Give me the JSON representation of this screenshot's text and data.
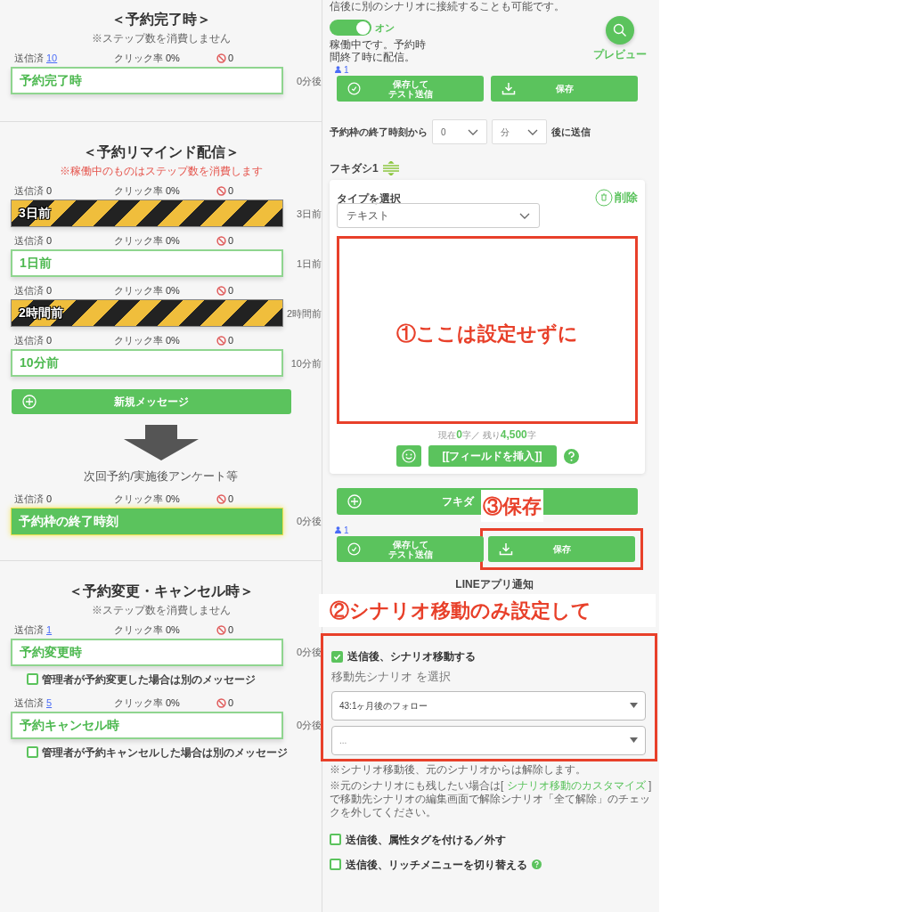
{
  "sections": [
    {
      "title": "＜予約完了時＞",
      "note": "※ステップ数を消費しません",
      "warning": false,
      "items": [
        {
          "kind": "message",
          "sent_label": "送信済",
          "sent": "10",
          "sent_link": true,
          "click_label": "クリック率",
          "click": "0%",
          "blocked": "0",
          "label": "予約完了時",
          "active": true,
          "selected": false,
          "timing": "0分後"
        }
      ]
    },
    {
      "title": "＜予約リマインド配信＞",
      "note": "※稼働中のものはステップ数を消費します",
      "warning": true,
      "items": [
        {
          "kind": "message",
          "sent_label": "送信済",
          "sent": "0",
          "sent_link": false,
          "click_label": "クリック率",
          "click": "0%",
          "blocked": "0",
          "label": "3日前",
          "active": false,
          "selected": false,
          "timing": "3日前"
        },
        {
          "kind": "message",
          "sent_label": "送信済",
          "sent": "0",
          "sent_link": false,
          "click_label": "クリック率",
          "click": "0%",
          "blocked": "0",
          "label": "1日前",
          "active": true,
          "selected": false,
          "timing": "1日前"
        },
        {
          "kind": "message",
          "sent_label": "送信済",
          "sent": "0",
          "sent_link": false,
          "click_label": "クリック率",
          "click": "0%",
          "blocked": "0",
          "label": "2時間前",
          "active": false,
          "selected": false,
          "timing": "2時間前"
        },
        {
          "kind": "message",
          "sent_label": "送信済",
          "sent": "0",
          "sent_link": false,
          "click_label": "クリック率",
          "click": "0%",
          "blocked": "0",
          "label": "10分前",
          "active": true,
          "selected": false,
          "timing": "10分前"
        },
        {
          "kind": "add_button",
          "label": "新規メッセージ"
        },
        {
          "kind": "arrow",
          "label": "次回予約/実施後アンケート等"
        },
        {
          "kind": "message",
          "sent_label": "送信済",
          "sent": "0",
          "sent_link": false,
          "click_label": "クリック率",
          "click": "0%",
          "blocked": "0",
          "label": "予約枠の終了時刻",
          "active": true,
          "selected": true,
          "timing": "0分後"
        }
      ]
    },
    {
      "title": "＜予約変更・キャンセル時＞",
      "note": "※ステップ数を消費しません",
      "warning": false,
      "items": [
        {
          "kind": "message",
          "sent_label": "送信済",
          "sent": "1",
          "sent_link": true,
          "click_label": "クリック率",
          "click": "0%",
          "blocked": "0",
          "label": "予約変更時",
          "active": true,
          "selected": false,
          "timing": "0分後"
        },
        {
          "kind": "checkbox",
          "label": "管理者が予約変更した場合は別のメッセージ",
          "checked": false
        },
        {
          "kind": "message",
          "sent_label": "送信済",
          "sent": "5",
          "sent_link": true,
          "click_label": "クリック率",
          "click": "0%",
          "blocked": "0",
          "label": "予約キャンセル時",
          "active": true,
          "selected": false,
          "timing": "0分後"
        },
        {
          "kind": "checkbox",
          "label": "管理者が予約キャンセルした場合は別のメッセージ",
          "checked": false
        }
      ]
    }
  ],
  "editor": {
    "top_note": "信後に別のシナリオに接続することも可能です。",
    "toggle": {
      "on": true,
      "label": "オン",
      "status": "稼働中です。予約時間終了時に配信。"
    },
    "preview": "プレビュー",
    "recipients": "1",
    "test_button": [
      "保存して",
      "テスト送信"
    ],
    "save_button": "保存",
    "timing": {
      "prefix": "予約枠の終了時刻から",
      "amount": "0",
      "unit": "分",
      "suffix": "後に送信"
    },
    "bubble": {
      "title": "フキダシ1",
      "type_label": "タイプを選択",
      "delete": "削除",
      "type": "テキスト",
      "counter": {
        "prefix": "現在",
        "current": "0",
        "middle": "字／ 残り",
        "remaining": "4,500",
        "suffix": "字"
      },
      "insert_field": "[[フィールドを挿入]]"
    },
    "add_bubble": "フキダ",
    "recipients_2": "1",
    "test_button_2": [
      "保存して",
      "テスト送信"
    ],
    "save_button_2": "保存",
    "line_notify": "LINEアプリ通知",
    "scenario_move": {
      "checked": true,
      "label": "送信後、シナリオ移動する",
      "select_label": "移動先シナリオ を選択",
      "scenario": "43:1ヶ月後のフォロー",
      "second": "..."
    },
    "notes": [
      {
        "text": "※シナリオ移動後、元のシナリオからは解除します。"
      },
      {
        "before": "※元のシナリオにも残したい場合は[ ",
        "link": "シナリオ移動のカスタマイズ",
        "after": " ]で移動先シナリオの編集画面で解除シナリオ「全て解除」のチェックを外してください。"
      }
    ],
    "options": [
      {
        "label": "送信後、属性タグを付ける／外す",
        "checked": false,
        "help": false
      },
      {
        "label": "送信後、リッチメニューを切り替える",
        "checked": false,
        "help": true
      }
    ]
  },
  "annotations": [
    "①ここは設定せずに",
    "③保存",
    "②シナリオ移動のみ設定して"
  ]
}
